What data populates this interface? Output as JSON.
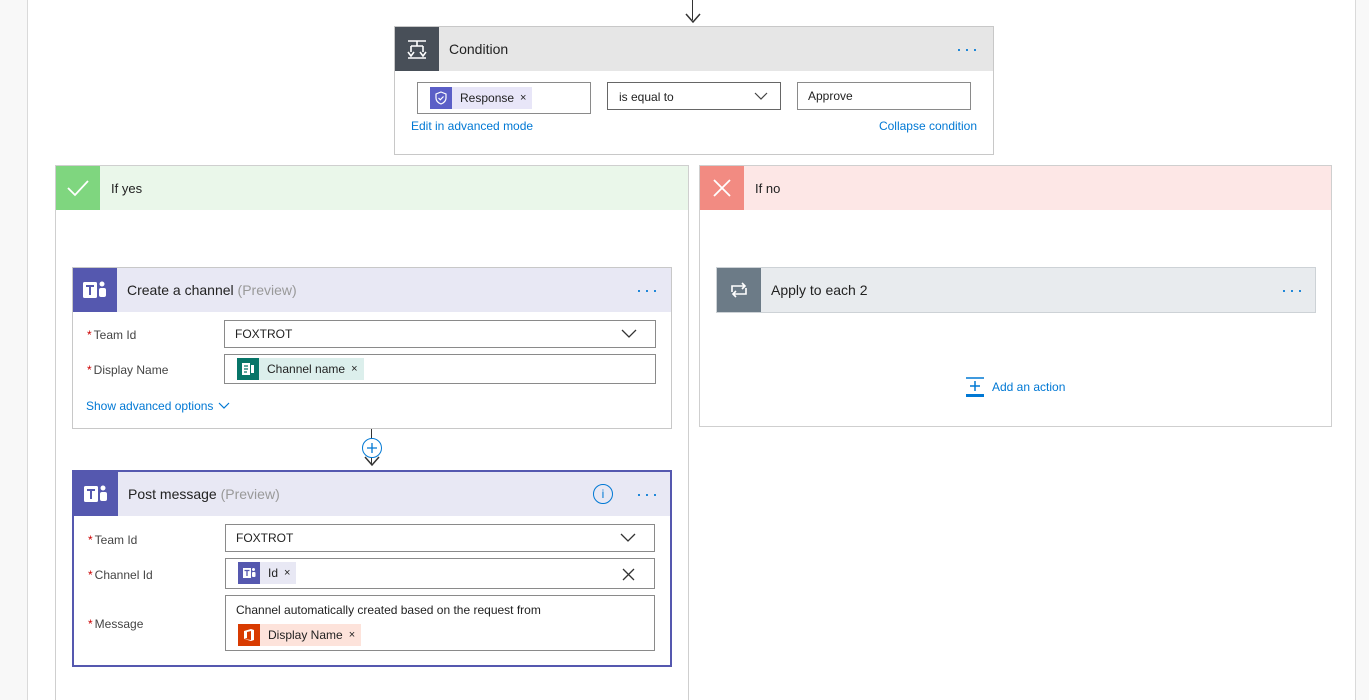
{
  "condition": {
    "title": "Condition",
    "more_label": "···",
    "operand_token": "Response",
    "operator": "is equal to",
    "value": "Approve",
    "edit_advanced_link": "Edit in advanced mode",
    "collapse_link": "Collapse condition"
  },
  "yes_branch": {
    "label": "If yes",
    "color": "#7fd67f"
  },
  "no_branch": {
    "label": "If no",
    "color": "#f28b82"
  },
  "create_channel": {
    "title": "Create a channel",
    "preview": "(Preview)",
    "more_label": "···",
    "team_id_label": "Team Id",
    "team_id_value": "FOXTROT",
    "display_name_label": "Display Name",
    "display_name_token": "Channel name",
    "advanced_link": "Show advanced options"
  },
  "post_message": {
    "title": "Post message",
    "preview": "(Preview)",
    "more_label": "···",
    "info_label": "i",
    "team_id_label": "Team Id",
    "team_id_value": "FOXTROT",
    "channel_id_label": "Channel Id",
    "channel_id_token": "Id",
    "message_label": "Message",
    "message_text": "Channel automatically created based on the request from",
    "message_token": "Display Name"
  },
  "apply_each": {
    "title": "Apply to each 2",
    "more_label": "···"
  },
  "add_action": {
    "label": "Add an action"
  },
  "required_mark": "*",
  "token_close": "×",
  "colors": {
    "teams": "#5558af",
    "forms": "#077568",
    "office": "#d83b01",
    "approvals": "#5b5fc7",
    "condition_icon": "#484f58",
    "loop_icon": "#6c7b87",
    "link": "#0078d4"
  }
}
